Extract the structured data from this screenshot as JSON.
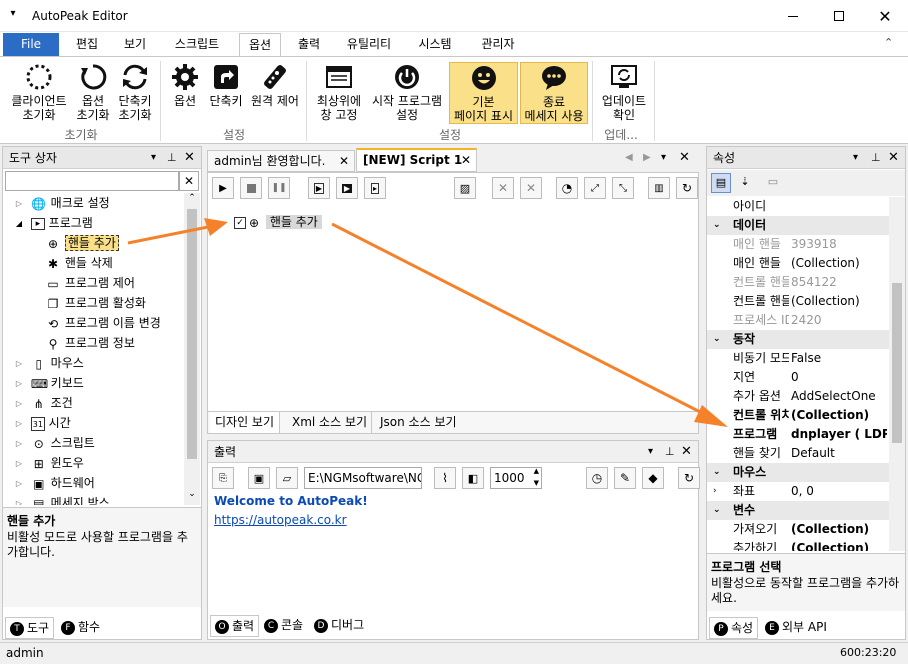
{
  "app": {
    "title": "AutoPeak Editor",
    "status_user": "admin",
    "status_time": "600:23:20"
  },
  "menu": {
    "file": "File",
    "tabs": [
      "편집",
      "보기",
      "스크립트",
      "옵션",
      "출력",
      "유틸리티",
      "시스템",
      "관리자"
    ]
  },
  "ribbon": {
    "buttons": [
      {
        "label1": "클라이언트",
        "label2": "초기화"
      },
      {
        "label1": "옵션",
        "label2": "초기화"
      },
      {
        "label1": "단축키",
        "label2": "초기화"
      },
      {
        "label1": "옵션",
        "label2": ""
      },
      {
        "label1": "단축키",
        "label2": ""
      },
      {
        "label1": "원격 제어",
        "label2": ""
      },
      {
        "label1": "최상위에",
        "label2": "창 고정"
      },
      {
        "label1": "시작 프로그램",
        "label2": "설정"
      },
      {
        "label1": "기본",
        "label2": "페이지 표시"
      },
      {
        "label1": "종료",
        "label2": "메세지 사용"
      },
      {
        "label1": "업데이트",
        "label2": "확인"
      }
    ],
    "groups": [
      "초기화",
      "설정",
      "설정",
      "업데..."
    ]
  },
  "toolbox": {
    "header": "도구 상자",
    "items": [
      "매크로 설정",
      "프로그램",
      "핸들 추가",
      "핸들 삭제",
      "프로그램 제어",
      "프로그램 활성화",
      "프로그램 이름 변경",
      "프로그램 정보",
      "마우스",
      "키보드",
      "조건",
      "시간",
      "스크립트",
      "윈도우",
      "하드웨어",
      "메세지 박스"
    ],
    "desc_title": "핸들 추가",
    "desc_text": "비활성 모드로 사용할 프로그램을 추가합니다.",
    "tab_tools": "도구",
    "tab_funcs": "함수"
  },
  "editor": {
    "tab_welcome": "admin님 환영합니다.",
    "tab_script": "[NEW] Script 1",
    "node_label": "핸들 추가",
    "view_tabs": [
      "디자인 보기",
      "Xml 소스 보기",
      "Json 소스 보기"
    ]
  },
  "output": {
    "header": "출력",
    "path": "E:\\NGMsoftware\\NG",
    "delay": "1000",
    "welcome": "Welcome to AutoPeak!",
    "link": "https://autopeak.co.kr",
    "tabs": [
      "출력",
      "콘솔",
      "디버그"
    ]
  },
  "properties": {
    "header": "속성",
    "rows": [
      {
        "k": "아이디",
        "v": "",
        "t": "n"
      },
      {
        "k": "데이터",
        "v": "",
        "t": "c"
      },
      {
        "k": "매인 핸들",
        "v": "393918",
        "t": "g"
      },
      {
        "k": "매인 핸들",
        "v": "(Collection)",
        "t": "n"
      },
      {
        "k": "컨트롤 핸들",
        "v": "854122",
        "t": "g"
      },
      {
        "k": "컨트롤 핸들",
        "v": "(Collection)",
        "t": "n"
      },
      {
        "k": "프로세스 ID",
        "v": "2420",
        "t": "g"
      },
      {
        "k": "동작",
        "v": "",
        "t": "c"
      },
      {
        "k": "비동기 모드",
        "v": "False",
        "t": "n"
      },
      {
        "k": "지연",
        "v": "0",
        "t": "n"
      },
      {
        "k": "추가 옵션",
        "v": "AddSelectOne",
        "t": "n"
      },
      {
        "k": "컨트롤 위치",
        "v": "(Collection)",
        "t": "b"
      },
      {
        "k": "프로그램",
        "v": "dnplayer ( LDPla",
        "t": "b"
      },
      {
        "k": "핸들 찾기",
        "v": "Default",
        "t": "n"
      },
      {
        "k": "마우스",
        "v": "",
        "t": "c"
      },
      {
        "k": "좌표",
        "v": "0, 0",
        "t": "n"
      },
      {
        "k": "변수",
        "v": "",
        "t": "c"
      },
      {
        "k": "가져오기",
        "v": "(Collection)",
        "t": "b"
      },
      {
        "k": "추가하기",
        "v": "(Collection)",
        "t": "b"
      }
    ],
    "desc_title": "프로그램 선택",
    "desc_text": "비활성으로 동작할 프로그램을 추가하세요.",
    "tab_props": "속성",
    "tab_api": "외부 API"
  },
  "colors": {
    "accent": "#2b6cc4",
    "highlight": "#fbe08a",
    "arrow": "#f5822a",
    "link": "#0b4bb3"
  }
}
